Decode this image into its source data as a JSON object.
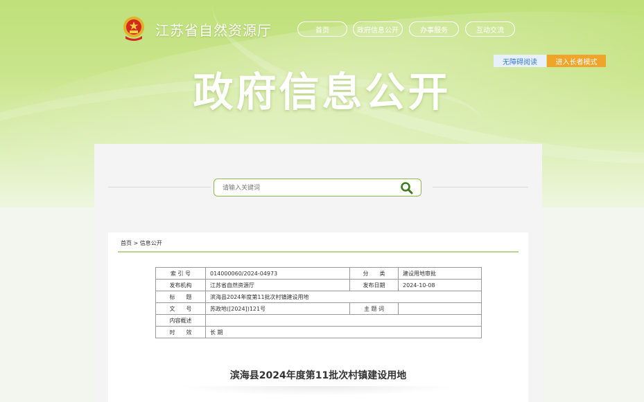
{
  "header": {
    "site_name": "江苏省自然资源厅",
    "nav": [
      "首页",
      "政府信息公开",
      "办事服务",
      "互动交流"
    ],
    "accessibility_label": "无障碍阅读",
    "elder_mode_label": "进入长者模式",
    "hero_title": "政府信息公开"
  },
  "search": {
    "placeholder": "请输入关键词"
  },
  "breadcrumb": {
    "home": "首页",
    "sep": ">",
    "current": "信息公开"
  },
  "meta": {
    "index_label": "索 引 号",
    "index_value": "014000060/2024-04973",
    "category_label": "分　　类",
    "category_value": "建设用地审批",
    "publisher_label": "发布机构",
    "publisher_value": "江苏省自然资源厅",
    "date_label": "发布日期",
    "date_value": "2024-10-08",
    "title_label": "标　　题",
    "title_value": "滨海县2024年度第11批次村镇建设用地",
    "docno_label": "文　　号",
    "docno_value": "苏政地([2024])121号",
    "keyword_label": "主 题 词",
    "keyword_value": "",
    "summary_label": "内容概述",
    "summary_value": "",
    "validity_label": "时　　效",
    "validity_value": "长 期"
  },
  "document": {
    "title": "滨海县2024年度第11批次村镇建设用地"
  },
  "colors": {
    "accent_green": "#8dba49",
    "elder_orange": "#f0a42a",
    "accessibility_blue": "#3b7bd0"
  }
}
